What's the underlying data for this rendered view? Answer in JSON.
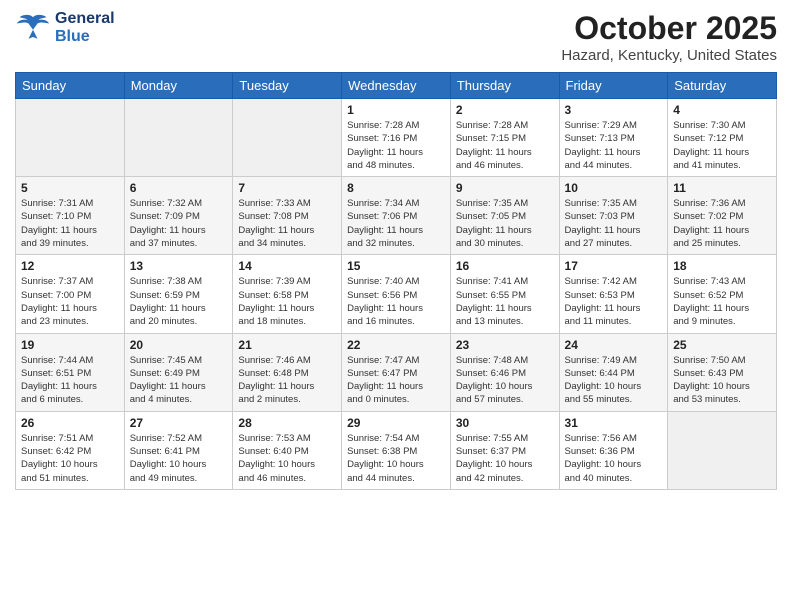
{
  "header": {
    "logo_general": "General",
    "logo_blue": "Blue",
    "month_title": "October 2025",
    "location": "Hazard, Kentucky, United States"
  },
  "days_of_week": [
    "Sunday",
    "Monday",
    "Tuesday",
    "Wednesday",
    "Thursday",
    "Friday",
    "Saturday"
  ],
  "weeks": [
    {
      "cells": [
        {
          "day": "",
          "info": ""
        },
        {
          "day": "",
          "info": ""
        },
        {
          "day": "",
          "info": ""
        },
        {
          "day": "1",
          "info": "Sunrise: 7:28 AM\nSunset: 7:16 PM\nDaylight: 11 hours\nand 48 minutes."
        },
        {
          "day": "2",
          "info": "Sunrise: 7:28 AM\nSunset: 7:15 PM\nDaylight: 11 hours\nand 46 minutes."
        },
        {
          "day": "3",
          "info": "Sunrise: 7:29 AM\nSunset: 7:13 PM\nDaylight: 11 hours\nand 44 minutes."
        },
        {
          "day": "4",
          "info": "Sunrise: 7:30 AM\nSunset: 7:12 PM\nDaylight: 11 hours\nand 41 minutes."
        }
      ]
    },
    {
      "cells": [
        {
          "day": "5",
          "info": "Sunrise: 7:31 AM\nSunset: 7:10 PM\nDaylight: 11 hours\nand 39 minutes."
        },
        {
          "day": "6",
          "info": "Sunrise: 7:32 AM\nSunset: 7:09 PM\nDaylight: 11 hours\nand 37 minutes."
        },
        {
          "day": "7",
          "info": "Sunrise: 7:33 AM\nSunset: 7:08 PM\nDaylight: 11 hours\nand 34 minutes."
        },
        {
          "day": "8",
          "info": "Sunrise: 7:34 AM\nSunset: 7:06 PM\nDaylight: 11 hours\nand 32 minutes."
        },
        {
          "day": "9",
          "info": "Sunrise: 7:35 AM\nSunset: 7:05 PM\nDaylight: 11 hours\nand 30 minutes."
        },
        {
          "day": "10",
          "info": "Sunrise: 7:35 AM\nSunset: 7:03 PM\nDaylight: 11 hours\nand 27 minutes."
        },
        {
          "day": "11",
          "info": "Sunrise: 7:36 AM\nSunset: 7:02 PM\nDaylight: 11 hours\nand 25 minutes."
        }
      ]
    },
    {
      "cells": [
        {
          "day": "12",
          "info": "Sunrise: 7:37 AM\nSunset: 7:00 PM\nDaylight: 11 hours\nand 23 minutes."
        },
        {
          "day": "13",
          "info": "Sunrise: 7:38 AM\nSunset: 6:59 PM\nDaylight: 11 hours\nand 20 minutes."
        },
        {
          "day": "14",
          "info": "Sunrise: 7:39 AM\nSunset: 6:58 PM\nDaylight: 11 hours\nand 18 minutes."
        },
        {
          "day": "15",
          "info": "Sunrise: 7:40 AM\nSunset: 6:56 PM\nDaylight: 11 hours\nand 16 minutes."
        },
        {
          "day": "16",
          "info": "Sunrise: 7:41 AM\nSunset: 6:55 PM\nDaylight: 11 hours\nand 13 minutes."
        },
        {
          "day": "17",
          "info": "Sunrise: 7:42 AM\nSunset: 6:53 PM\nDaylight: 11 hours\nand 11 minutes."
        },
        {
          "day": "18",
          "info": "Sunrise: 7:43 AM\nSunset: 6:52 PM\nDaylight: 11 hours\nand 9 minutes."
        }
      ]
    },
    {
      "cells": [
        {
          "day": "19",
          "info": "Sunrise: 7:44 AM\nSunset: 6:51 PM\nDaylight: 11 hours\nand 6 minutes."
        },
        {
          "day": "20",
          "info": "Sunrise: 7:45 AM\nSunset: 6:49 PM\nDaylight: 11 hours\nand 4 minutes."
        },
        {
          "day": "21",
          "info": "Sunrise: 7:46 AM\nSunset: 6:48 PM\nDaylight: 11 hours\nand 2 minutes."
        },
        {
          "day": "22",
          "info": "Sunrise: 7:47 AM\nSunset: 6:47 PM\nDaylight: 11 hours\nand 0 minutes."
        },
        {
          "day": "23",
          "info": "Sunrise: 7:48 AM\nSunset: 6:46 PM\nDaylight: 10 hours\nand 57 minutes."
        },
        {
          "day": "24",
          "info": "Sunrise: 7:49 AM\nSunset: 6:44 PM\nDaylight: 10 hours\nand 55 minutes."
        },
        {
          "day": "25",
          "info": "Sunrise: 7:50 AM\nSunset: 6:43 PM\nDaylight: 10 hours\nand 53 minutes."
        }
      ]
    },
    {
      "cells": [
        {
          "day": "26",
          "info": "Sunrise: 7:51 AM\nSunset: 6:42 PM\nDaylight: 10 hours\nand 51 minutes."
        },
        {
          "day": "27",
          "info": "Sunrise: 7:52 AM\nSunset: 6:41 PM\nDaylight: 10 hours\nand 49 minutes."
        },
        {
          "day": "28",
          "info": "Sunrise: 7:53 AM\nSunset: 6:40 PM\nDaylight: 10 hours\nand 46 minutes."
        },
        {
          "day": "29",
          "info": "Sunrise: 7:54 AM\nSunset: 6:38 PM\nDaylight: 10 hours\nand 44 minutes."
        },
        {
          "day": "30",
          "info": "Sunrise: 7:55 AM\nSunset: 6:37 PM\nDaylight: 10 hours\nand 42 minutes."
        },
        {
          "day": "31",
          "info": "Sunrise: 7:56 AM\nSunset: 6:36 PM\nDaylight: 10 hours\nand 40 minutes."
        },
        {
          "day": "",
          "info": ""
        }
      ]
    }
  ]
}
